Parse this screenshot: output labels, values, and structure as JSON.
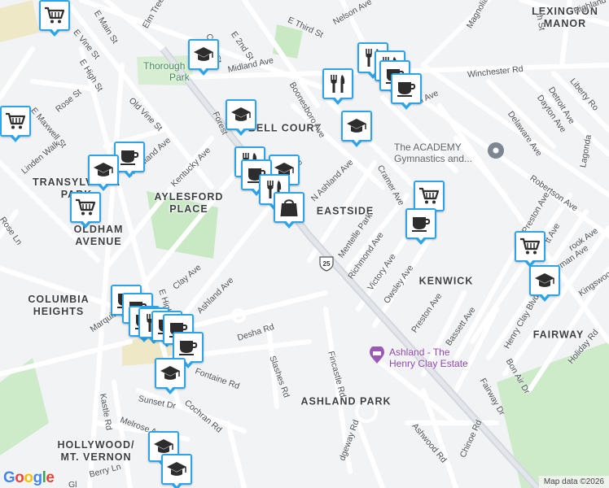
{
  "neighborhoods": [
    {
      "name": "LEXINGTON\nMANOR"
    },
    {
      "name": "BELL COURT"
    },
    {
      "name": "TRANSYLVANIA\nPARK"
    },
    {
      "name": "AYLESFORD\nPLACE"
    },
    {
      "name": "EASTSIDE"
    },
    {
      "name": "OLDHAM\nAVENUE"
    },
    {
      "name": "KENWICK"
    },
    {
      "name": "COLUMBIA\nHEIGHTS"
    },
    {
      "name": "FAIRWAY"
    },
    {
      "name": "ASHLAND PARK"
    },
    {
      "name": "HOLLYWOOD/\nMT. VERNON"
    }
  ],
  "streets": [
    "E Main St",
    "Elm Tree Ln",
    "E Third St",
    "Nelson Ave",
    "Magnolia",
    "th St",
    "Highland",
    "E Vine St",
    "E High St",
    "Coral St",
    "E 2nd St",
    "Midland Ave",
    "Winchester Rd",
    "Dayton Ave",
    "E Maxwell St",
    "Rose St",
    "Old Vine St",
    "Forest",
    "Boonesboro Ave",
    "al Ave",
    "Delaware Ave",
    "Detroit Ave",
    "Liberty Ro",
    "Linden Walk",
    "Woodland Ave",
    "Kentucky Ave",
    "e",
    "N Ashland Ave",
    "Cramer Ave",
    "Lagonda",
    "Robertson Ave",
    "Rose Ln",
    "Mentelle Park",
    "Preston Ave",
    "tt Ave",
    "rook Ave",
    "Richmond Ave",
    "Sherman Ave",
    "Kingswood",
    "Clay Ave",
    "E High",
    "Ashland Ave",
    "Victory Ave",
    "Owsley Ave",
    "Marquis Av",
    "Desha Rd",
    "Preston Ave",
    "Bassett Ave",
    "Henry Clay Blvd",
    "Holiday Rd",
    "Bon Air Dr",
    "Fairway Dr",
    "Slashes Rd",
    "Fincastle Rd",
    "Fontaine Rd",
    "Sunset Dr",
    "Cochran Rd",
    "Kastle Rd",
    "Melrose Ave",
    "Ashwood Rd",
    "Chinoe Rd",
    "dgeway Rd",
    "Berry Ln",
    "Gl"
  ],
  "pois": [
    {
      "name": "Thorough\nPark",
      "color": "green"
    },
    {
      "name": "The ACADEMY\nGymnastics and...",
      "color": "gray"
    },
    {
      "name": "Ashland - The\nHenry Clay Estate",
      "color": "purple"
    }
  ],
  "route_shield": "25",
  "markers": [
    {
      "icon": "shopping-cart-icon"
    },
    {
      "icon": "graduation-cap-icon"
    },
    {
      "icon": "restaurant-icon"
    },
    {
      "icon": "restaurant-icon"
    },
    {
      "icon": "coffee-cup-icon"
    },
    {
      "icon": "coffee-cup-icon"
    },
    {
      "icon": "restaurant-icon"
    },
    {
      "icon": "shopping-cart-icon"
    },
    {
      "icon": "graduation-cap-icon"
    },
    {
      "icon": "graduation-cap-icon"
    },
    {
      "icon": "coffee-cup-icon"
    },
    {
      "icon": "graduation-cap-icon"
    },
    {
      "icon": "restaurant-icon"
    },
    {
      "icon": "graduation-cap-icon"
    },
    {
      "icon": "coffee-cup-icon"
    },
    {
      "icon": "restaurant-icon"
    },
    {
      "icon": "shopping-bag-icon"
    },
    {
      "icon": "shopping-cart-icon"
    },
    {
      "icon": "shopping-cart-icon"
    },
    {
      "icon": "coffee-cup-icon"
    },
    {
      "icon": "shopping-cart-icon"
    },
    {
      "icon": "graduation-cap-icon"
    },
    {
      "icon": "coffee-cup-icon"
    },
    {
      "icon": "coffee-cup-icon"
    },
    {
      "icon": "coffee-cup-icon"
    },
    {
      "icon": "restaurant-icon"
    },
    {
      "icon": "coffee-cup-icon"
    },
    {
      "icon": "coffee-cup-icon"
    },
    {
      "icon": "coffee-cup-icon"
    },
    {
      "icon": "graduation-cap-icon"
    },
    {
      "icon": "graduation-cap-icon"
    },
    {
      "icon": "graduation-cap-icon"
    }
  ],
  "logo": "Google",
  "attribution": "Map data ©2026",
  "colors": {
    "marker_border": "#2ea4e8",
    "park": "#c9e9c5",
    "road": "#ffffff",
    "highway": "#d3d8de"
  }
}
